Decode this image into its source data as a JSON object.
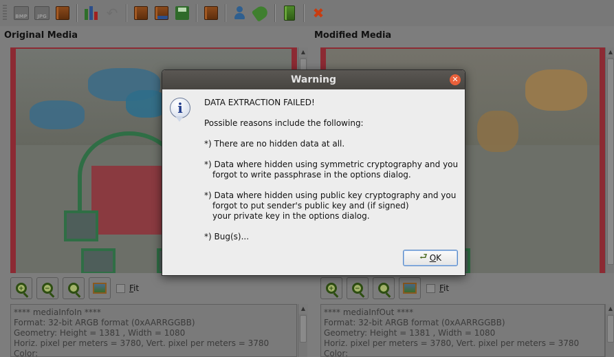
{
  "toolbar": {
    "items": [
      {
        "name": "bmp-icon",
        "label": "BMP"
      },
      {
        "name": "jpg-icon",
        "label": "JPG"
      },
      {
        "name": "book-icon"
      },
      {
        "name": "chart-icon"
      },
      {
        "name": "undo-icon"
      },
      {
        "name": "open-book-icon"
      },
      {
        "name": "import-book-icon"
      },
      {
        "name": "save-icon"
      },
      {
        "name": "notebook-icon"
      },
      {
        "name": "user-icon"
      },
      {
        "name": "tag-icon"
      },
      {
        "name": "green-book-icon"
      },
      {
        "name": "close-x-icon"
      }
    ]
  },
  "left_panel": {
    "title": "Original Media",
    "info_lines": [
      "**** mediaInfoIn ****",
      "Format: 32-bit ARGB format (0xAARRGGBB)",
      "Geometry: Height = 1381 , Width = 1080",
      "Horiz. pixel per meters =  3780, Vert. pixel per meters = 3780",
      "Color:"
    ]
  },
  "right_panel": {
    "title": "Modified Media",
    "info_lines": [
      "**** mediaInfOut ****",
      "Format: 32-bit ARGB format (0xAARRGGBB)",
      "Geometry: Height = 1381 , Width = 1080",
      "Horiz. pixel per meters =  3780, Vert. pixel per meters = 3780",
      "Color:"
    ]
  },
  "zoom": {
    "fit_label": "Fit",
    "fit_mnemonic": "F",
    "fit_rest": "it",
    "zoom_in_glyph": "+",
    "zoom_out_glyph": "−"
  },
  "dialog": {
    "title": "Warning",
    "close_glyph": "✕",
    "icon_glyph": "i",
    "heading": "DATA EXTRACTION FAILED!",
    "intro": "Possible reasons include the following:",
    "reason1": "*) There are no hidden data at all.",
    "reason2_line1": "*) Data where hidden using symmetric cryptography and you",
    "reason2_line2": "forgot to write passphrase in the options dialog.",
    "reason3_line1": "*) Data where hidden using public key cryptography and you",
    "reason3_line2": "forgot to put sender's public key and (if signed)",
    "reason3_line3": "your private key in the options dialog.",
    "reason4": "*) Bug(s)...",
    "ok_mnemonic": "O",
    "ok_rest": "K"
  },
  "colors": {
    "window_bg": "#7d7d7d",
    "dialog_bg": "#ededed",
    "title_bar": "#4f4c48",
    "close_button": "#e9603a",
    "frame_red": "#8c2a33"
  }
}
